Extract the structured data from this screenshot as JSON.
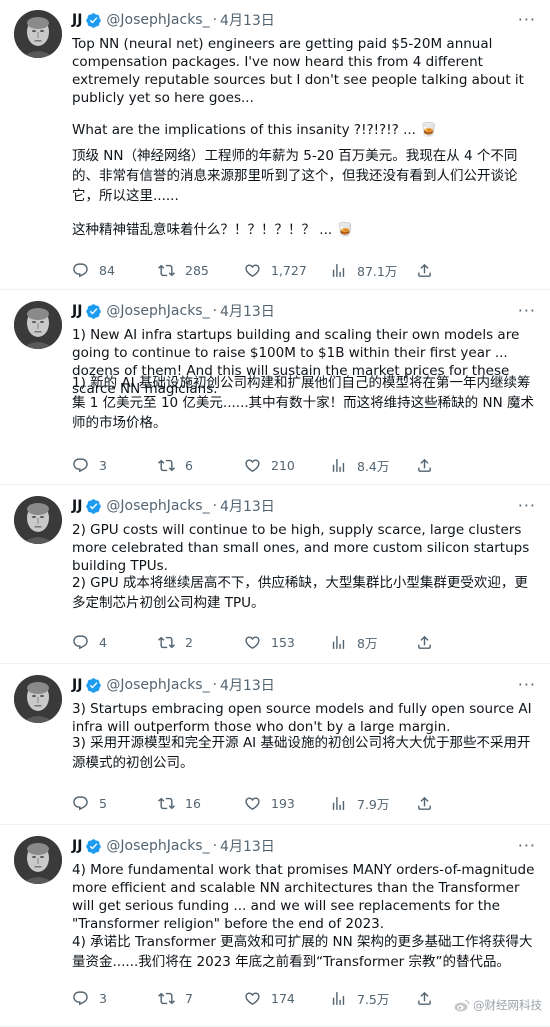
{
  "colors": {
    "verified": "#1d9bf0",
    "secondary_text": "#536471",
    "divider": "#eff3f4"
  },
  "author": {
    "name": "JJ",
    "handle": "@JosephJacks_",
    "separator": "·",
    "more": "···"
  },
  "tweets": [
    {
      "time": "4月13日",
      "paragraphs": [
        "Top NN (neural net) engineers are getting paid $5-20M annual compensation packages. I've now heard this from 4 different extremely reputable sources but I don't see people talking about it publicly yet so here goes...",
        "What are the implications of this insanity ?!?!?!? ... 🥃"
      ],
      "zh_paragraphs": [
        "顶级 NN（神经网络）工程师的年薪为 5-20 百万美元。我现在从 4 个不同的、非常有信誉的消息来源那里听到了这个，但我还没有看到人们公开谈论它，所以这里......",
        "这种精神错乱意味着什么？！？！？！？ ... 🥃"
      ],
      "replies": "84",
      "retweets": "285",
      "likes": "1,727",
      "views": "87.1万"
    },
    {
      "time": "4月13日",
      "paragraphs": [
        "1) New AI infra startups building and scaling their own models are going to continue to raise $100M to $1B within their first year ... dozens of them! And this will sustain the market prices for these scarce NN magicians."
      ],
      "zh_paragraphs": [
        "1) 新的 AI 基础设施初创公司构建和扩展他们自己的模型将在第一年内继续筹集 1 亿美元至 10 亿美元......其中有数十家！而这将维持这些稀缺的 NN 魔术师的市场价格。"
      ],
      "replies": "3",
      "retweets": "6",
      "likes": "210",
      "views": "8.4万"
    },
    {
      "time": "4月13日",
      "paragraphs": [
        "2) GPU costs will continue to be high, supply scarce, large clusters more celebrated than small ones, and more custom silicon startups building TPUs."
      ],
      "zh_paragraphs": [
        "2) GPU 成本将继续居高不下，供应稀缺，大型集群比小型集群更受欢迎，更多定制芯片初创公司构建 TPU。"
      ],
      "replies": "4",
      "retweets": "2",
      "likes": "153",
      "views": "8万"
    },
    {
      "time": "4月13日",
      "paragraphs": [
        "3) Startups embracing open source models and fully open source AI infra will outperform those who don't by a large margin."
      ],
      "zh_paragraphs": [
        "3) 采用开源模型和完全开源 AI 基础设施的初创公司将大大优于那些不采用开源模式的初创公司。"
      ],
      "replies": "5",
      "retweets": "16",
      "likes": "193",
      "views": "7.9万"
    },
    {
      "time": "4月13日",
      "paragraphs": [
        "4) More fundamental work that promises MANY orders-of-magnitude more efficient and scalable NN architectures than the Transformer will get serious funding ... and we will see replacements for the \"Transformer religion\" before the end of 2023."
      ],
      "zh_paragraphs": [
        "4) 承诺比 Transformer 更高效和可扩展的 NN 架构的更多基础工作将获得大量资金......我们将在 2023 年底之前看到“Transformer 宗教”的替代品。"
      ],
      "replies": "3",
      "retweets": "7",
      "likes": "174",
      "views": "7.5万"
    }
  ],
  "watermark": "@财经网科技"
}
